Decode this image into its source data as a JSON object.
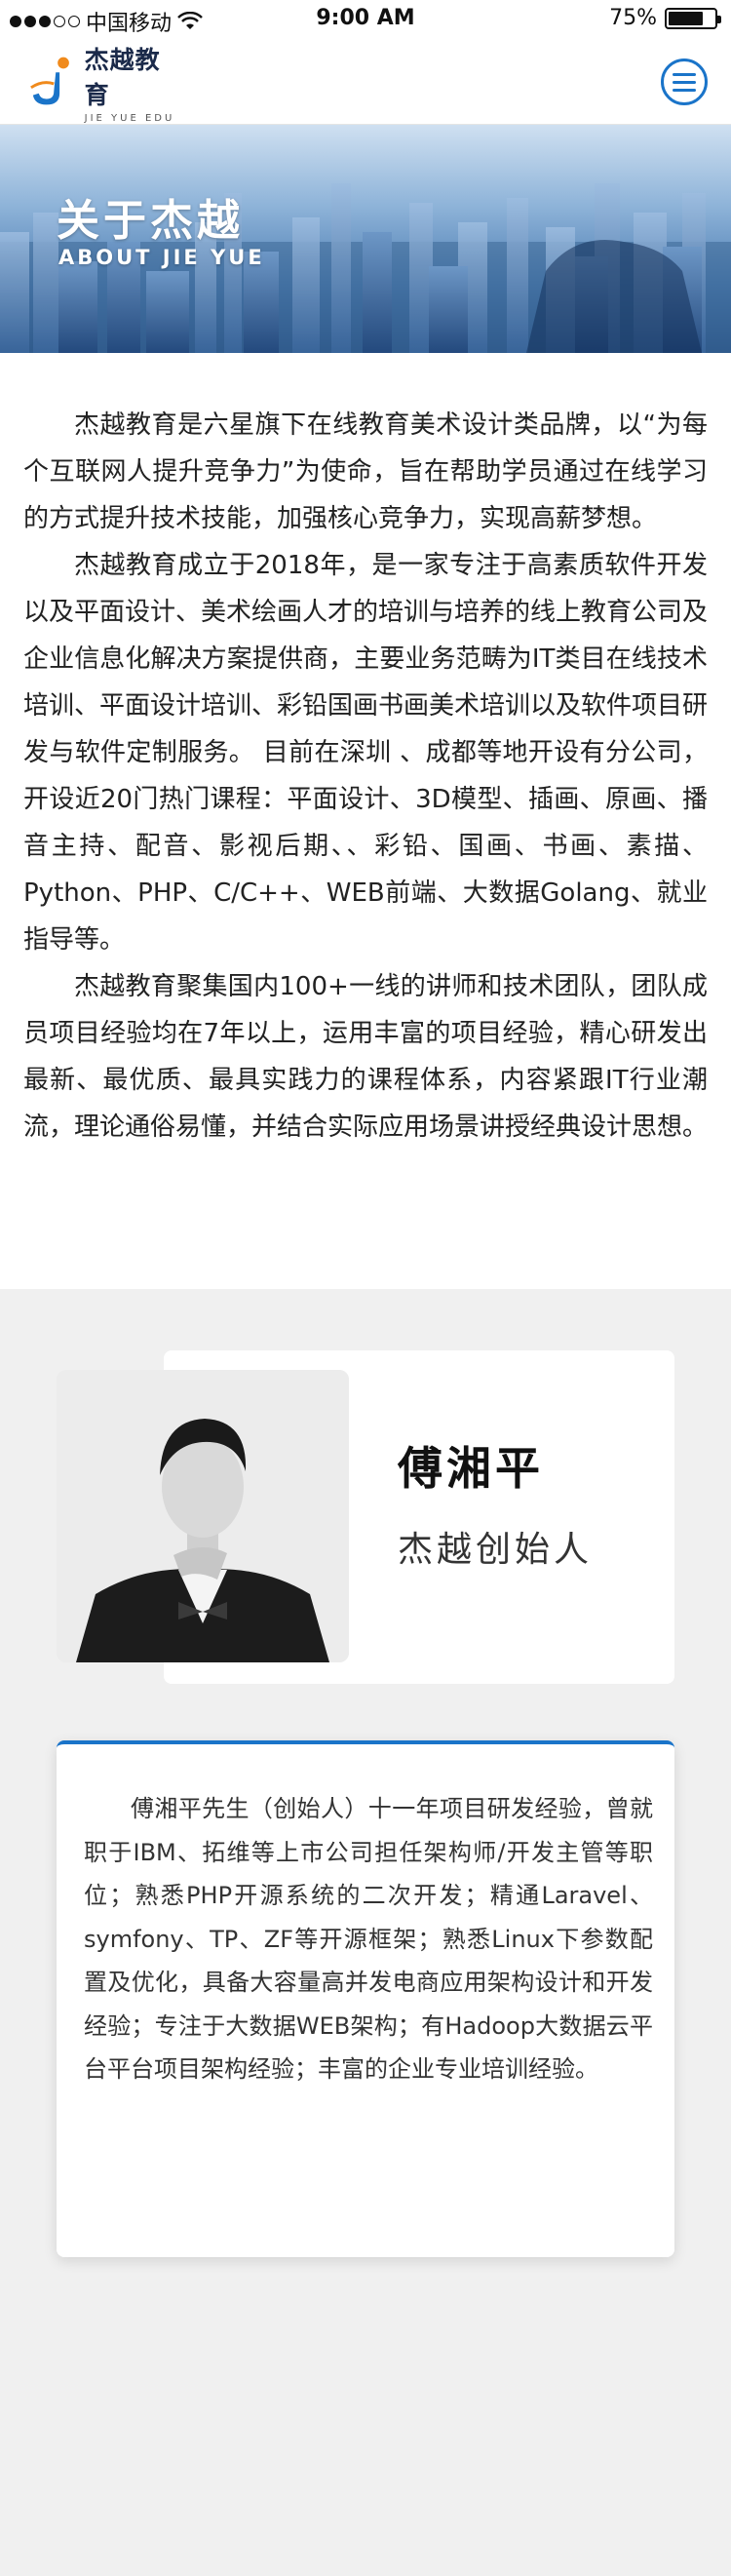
{
  "status_bar": {
    "carrier": "中国移动",
    "time": "9:00 AM",
    "battery": "75%",
    "battery_level": 0.75
  },
  "header": {
    "logo_name": "杰越教育",
    "logo_sub": "JIE YUE EDU",
    "menu_icon": "menu-icon",
    "accent_color": "#1a74c9"
  },
  "banner": {
    "title": "关于杰越",
    "subtitle": "ABOUT JIE YUE"
  },
  "intro": {
    "paragraphs": [
      "杰越教育是六星旗下在线教育美术设计类品牌，以“为每个互联网人提升竞争力”为使命，旨在帮助学员通过在线学习的方式提升技术技能，加强核心竞争力，实现高薪梦想。",
      "杰越教育成立于2018年，是一家专注于高素质软件开发以及平面设计、美术绘画人才的培训与培养的线上教育公司及企业信息化解决方案提供商，主要业务范畴为IT类目在线技术培训、平面设计培训、彩铅国画书画美术培训以及软件项目研发与软件定制服务。 目前在深圳 、成都等地开设有分公司，开设近20门热门课程：平面设计、3D模型、插画、原画、播音主持、配音、影视后期、、彩铅、国画、书画、素描、Python、PHP、C/C++、WEB前端、大数据Golang、就业指导等。",
      "杰越教育聚集国内100+一线的讲师和技术团队，团队成员项目经验均在7年以上，运用丰富的项目经验，精心研发出最新、最优质、最具实践力的课程体系，内容紧跟IT行业潮流，理论通俗易懂，并结合实际应用场景讲授经典设计思想。"
    ]
  },
  "founder": {
    "name": "傅湘平",
    "role": "杰越创始人",
    "bio": "傅湘平先生（创始人）十一年项目研发经验，曾就职于IBM、拓维等上市公司担任架构师/开发主管等职位；熟悉PHP开源系统的二次开发；精通Laravel、symfony、TP、ZF等开源框架；熟悉Linux下参数配置及优化，具备大容量高并发电商应用架构设计和开发经验；专注于大数据WEB架构；有Hadoop大数据云平台平台项目架构经验；丰富的企业专业培训经验。"
  }
}
